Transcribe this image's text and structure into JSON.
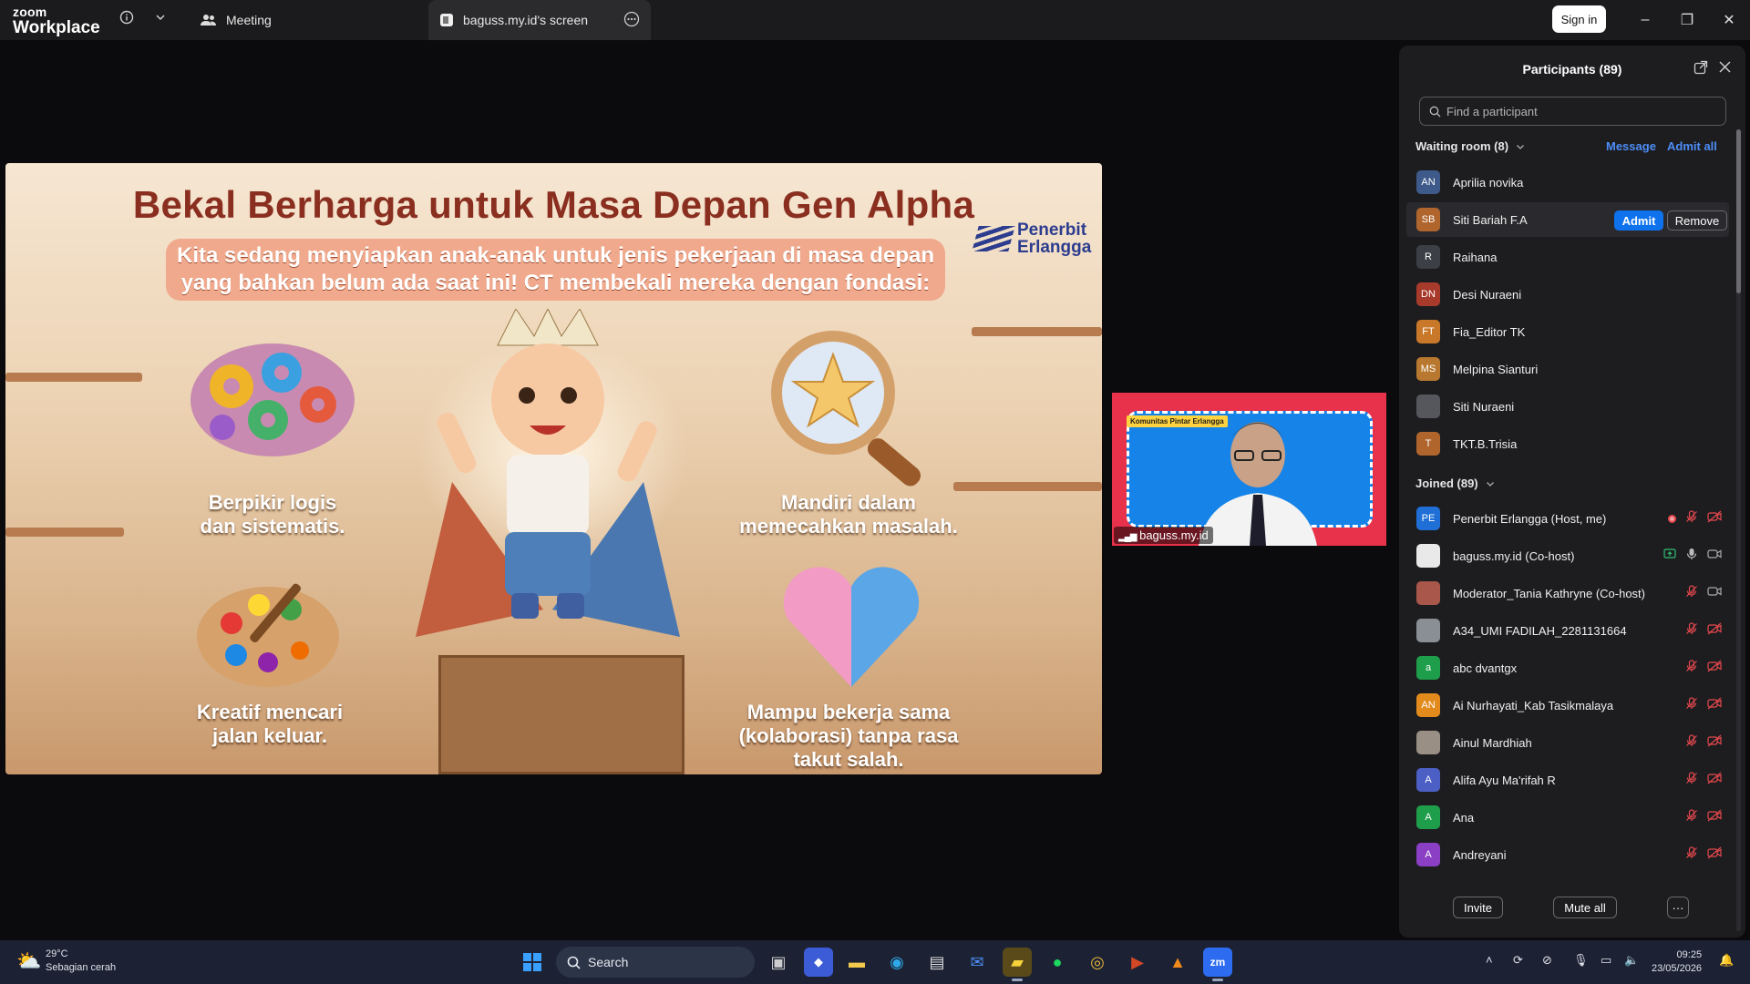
{
  "titlebar": {
    "logo_line1": "zoom",
    "logo_line2": "Workplace",
    "tab_meeting": "Meeting",
    "tab_screen": "baguss.my.id's screen",
    "signin": "Sign in",
    "minimize": "–",
    "restore": "❐",
    "close": "✕"
  },
  "slide": {
    "title": "Bekal Berharga untuk Masa Depan Gen Alpha",
    "subtitle_line1": "Kita sedang menyiapkan anak-anak untuk jenis pekerjaan di masa depan",
    "subtitle_line2": "yang bahkan belum ada saat ini! CT membekali mereka dengan fondasi:",
    "brand_line1": "Penerbit",
    "brand_line2": "Erlangga",
    "caption1_l1": "Berpikir logis",
    "caption1_l2": "dan sistematis.",
    "caption2_l1": "Mandiri dalam",
    "caption2_l2": "memecahkan masalah.",
    "caption3_l1": "Kreatif mencari",
    "caption3_l2": "jalan keluar.",
    "caption4_l1": "Mampu bekerja sama",
    "caption4_l2": "(kolaborasi) tanpa rasa",
    "caption4_l3": "takut salah."
  },
  "speaker": {
    "name": "baguss.my.id",
    "banner": "Komunitas Pintar Erlangga"
  },
  "panel": {
    "title": "Participants (89)",
    "search_placeholder": "Find a participant",
    "waiting_label": "Waiting room (8)",
    "message": "Message",
    "admit_all": "Admit all",
    "admit": "Admit",
    "remove": "Remove",
    "joined_label": "Joined (89)",
    "invite": "Invite",
    "mute_all": "Mute all",
    "more": "···",
    "waiting": [
      {
        "initials": "AN",
        "name": "Aprilia novika",
        "color": "#3d5a8a"
      },
      {
        "initials": "SB",
        "name": "Siti Bariah F.A",
        "color": "#b0652c"
      },
      {
        "initials": "R",
        "name": "Raihana",
        "color": "#3c3f46"
      },
      {
        "initials": "DN",
        "name": "Desi Nuraeni",
        "color": "#a83a2c"
      },
      {
        "initials": "FT",
        "name": "Fia_Editor TK",
        "color": "#c9782a"
      },
      {
        "initials": "MS",
        "name": "Melpina Sianturi",
        "color": "#b8782f"
      },
      {
        "initials": "",
        "name": "Siti Nuraeni",
        "color": "#55575c"
      },
      {
        "initials": "T",
        "name": "TKT.B.Trisia",
        "color": "#b0652c"
      }
    ],
    "joined": [
      {
        "initials": "PE",
        "name": "Penerbit Erlangga (Host, me)",
        "color": "#1f6fd6"
      },
      {
        "initials": "",
        "name": "baguss.my.id (Co-host)",
        "color": "#e9e9e9"
      },
      {
        "initials": "",
        "name": "Moderator_Tania Kathryne (Co-host)",
        "color": "#a8574a"
      },
      {
        "initials": "",
        "name": "A34_UMI FADILAH_2281131664",
        "color": "#8a8f96"
      },
      {
        "initials": "a",
        "name": "abc dvantgx",
        "color": "#1e9e4a"
      },
      {
        "initials": "AN",
        "name": "Ai Nurhayati_Kab Tasikmalaya",
        "color": "#e28a1c"
      },
      {
        "initials": "",
        "name": "Ainul Mardhiah",
        "color": "#9a8f84"
      },
      {
        "initials": "A",
        "name": "Alifa Ayu Ma'rifah R",
        "color": "#4b5fc4"
      },
      {
        "initials": "A",
        "name": "Ana",
        "color": "#1e9e4a"
      },
      {
        "initials": "A",
        "name": "Andreyani",
        "color": "#8a3fc4"
      }
    ]
  },
  "taskbar": {
    "weather_temp": "29°C",
    "weather_desc": "Sebagian cerah",
    "search": "Search",
    "time": "09:25",
    "date": "23/05/2026"
  }
}
